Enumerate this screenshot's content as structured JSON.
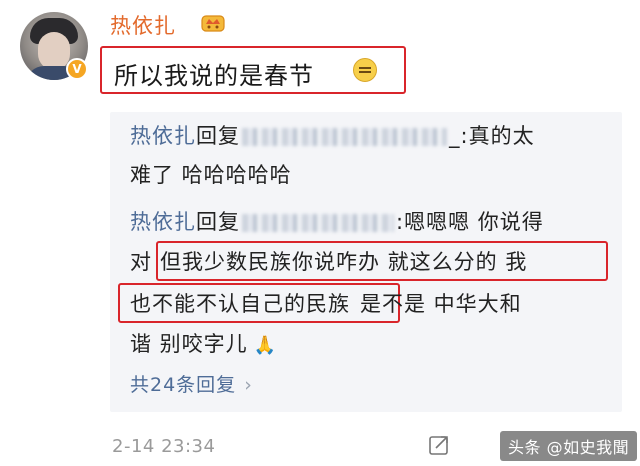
{
  "post": {
    "username": "热依扎",
    "vip_icon": "crown-icon",
    "main_text": "所以我说的是春节",
    "emoji_icon": "speechless-face-icon",
    "verified_icon": "verified-badge-icon",
    "verified_mark": "V"
  },
  "replies": [
    {
      "user": "热依扎",
      "reply_word": "回复",
      "line1_tail": "_:真的太",
      "line2": "难了 哈哈哈哈哈"
    },
    {
      "user": "热依扎",
      "reply_word": "回复",
      "line1_tail": ":嗯嗯嗯 你说得",
      "line2_pre": "对",
      "line2_hl": "但我少数民族你说咋办 就这么分的 我",
      "line3_hl": "也不能不认自己的民族",
      "line3_post": "是不是 中华大和",
      "line4": "谐 别咬字儿",
      "line4_emoji": "🙏"
    }
  ],
  "more_replies_label": "共24条回复",
  "more_chevron": "›",
  "timestamp": "2-14 23:34",
  "watermark": "头条 @如史我聞",
  "colors": {
    "username_orange": "#e36a2c",
    "reply_name_blue": "#4e6c97",
    "highlight_red": "#d9252b",
    "panel_bg": "#f4f5f8"
  }
}
